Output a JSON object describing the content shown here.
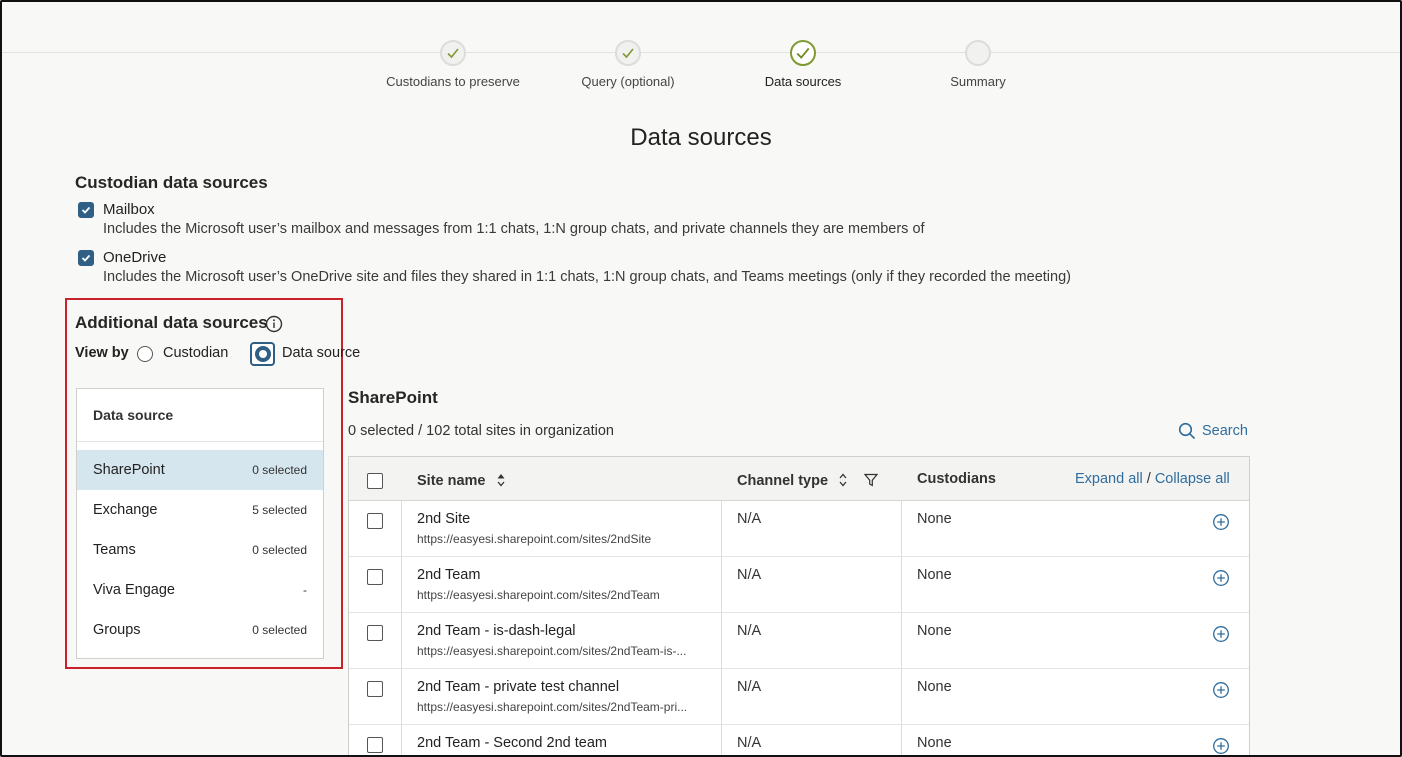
{
  "stepper": {
    "steps": [
      {
        "label": "Custodians to preserve",
        "state": "done"
      },
      {
        "label": "Query (optional)",
        "state": "done"
      },
      {
        "label": "Data sources",
        "state": "current"
      },
      {
        "label": "Summary",
        "state": "pending"
      }
    ]
  },
  "page_title": "Data sources",
  "custodian_sources": {
    "heading": "Custodian data sources",
    "options": [
      {
        "label": "Mailbox",
        "checked": true,
        "desc": "Includes the Microsoft user’s mailbox and messages from 1:1 chats, 1:N group chats, and private channels they are members of"
      },
      {
        "label": "OneDrive",
        "checked": true,
        "desc": "Includes the Microsoft user’s OneDrive site and files they shared in 1:1 chats, 1:N group chats, and Teams meetings (only if they recorded the meeting)"
      }
    ]
  },
  "additional_sources": {
    "heading": "Additional data sources",
    "view_by_label": "View by",
    "view_options": [
      "Custodian",
      "Data source"
    ],
    "selected_view": "Data source"
  },
  "ds_panel": {
    "header": "Data source",
    "items": [
      {
        "name": "SharePoint",
        "count": "0 selected",
        "selected": true
      },
      {
        "name": "Exchange",
        "count": "5 selected",
        "selected": false
      },
      {
        "name": "Teams",
        "count": "0 selected",
        "selected": false
      },
      {
        "name": "Viva Engage",
        "count": "-",
        "selected": false
      },
      {
        "name": "Groups",
        "count": "0 selected",
        "selected": false
      }
    ]
  },
  "sharepoint": {
    "title": "SharePoint",
    "count_text": "0 selected / 102 total sites in organization",
    "search_label": "Search",
    "table": {
      "headers": {
        "site_name": "Site name",
        "channel_type": "Channel type",
        "custodians": "Custodians"
      },
      "expand_all": "Expand all",
      "separator": "/",
      "collapse_all": "Collapse all",
      "rows": [
        {
          "name": "2nd Site",
          "url": "https://easyesi.sharepoint.com/sites/2ndSite",
          "channel": "N/A",
          "custodians": "None"
        },
        {
          "name": "2nd Team",
          "url": "https://easyesi.sharepoint.com/sites/2ndTeam",
          "channel": "N/A",
          "custodians": "None"
        },
        {
          "name": "2nd Team - is-dash-legal",
          "url": "https://easyesi.sharepoint.com/sites/2ndTeam-is-...",
          "channel": "N/A",
          "custodians": "None"
        },
        {
          "name": "2nd Team - private test channel",
          "url": "https://easyesi.sharepoint.com/sites/2ndTeam-pri...",
          "channel": "N/A",
          "custodians": "None"
        },
        {
          "name": "2nd Team - Second 2nd team",
          "url": "",
          "channel": "N/A",
          "custodians": "None"
        }
      ]
    }
  },
  "colors": {
    "accent": "#2f5f84",
    "link": "#2f6d9e",
    "highlight": "#c8232c",
    "step_done": "#7f9a32"
  }
}
